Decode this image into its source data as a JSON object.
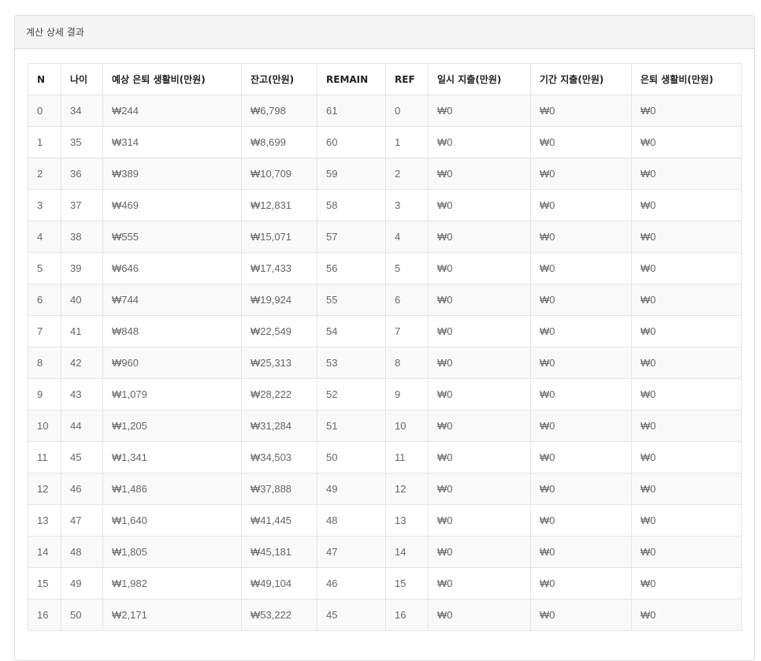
{
  "panel": {
    "title": "계산 상세 결과"
  },
  "table": {
    "headers": [
      "N",
      "나이",
      "예상 은퇴 생활비(만원)",
      "잔고(만원)",
      "REMAIN",
      "REF",
      "일시 지출(만원)",
      "기간 지출(만원)",
      "은퇴 생활비(만원)"
    ],
    "rows": [
      [
        "0",
        "34",
        "₩244",
        "₩6,798",
        "61",
        "0",
        "₩0",
        "₩0",
        "₩0"
      ],
      [
        "1",
        "35",
        "₩314",
        "₩8,699",
        "60",
        "1",
        "₩0",
        "₩0",
        "₩0"
      ],
      [
        "2",
        "36",
        "₩389",
        "₩10,709",
        "59",
        "2",
        "₩0",
        "₩0",
        "₩0"
      ],
      [
        "3",
        "37",
        "₩469",
        "₩12,831",
        "58",
        "3",
        "₩0",
        "₩0",
        "₩0"
      ],
      [
        "4",
        "38",
        "₩555",
        "₩15,071",
        "57",
        "4",
        "₩0",
        "₩0",
        "₩0"
      ],
      [
        "5",
        "39",
        "₩646",
        "₩17,433",
        "56",
        "5",
        "₩0",
        "₩0",
        "₩0"
      ],
      [
        "6",
        "40",
        "₩744",
        "₩19,924",
        "55",
        "6",
        "₩0",
        "₩0",
        "₩0"
      ],
      [
        "7",
        "41",
        "₩848",
        "₩22,549",
        "54",
        "7",
        "₩0",
        "₩0",
        "₩0"
      ],
      [
        "8",
        "42",
        "₩960",
        "₩25,313",
        "53",
        "8",
        "₩0",
        "₩0",
        "₩0"
      ],
      [
        "9",
        "43",
        "₩1,079",
        "₩28,222",
        "52",
        "9",
        "₩0",
        "₩0",
        "₩0"
      ],
      [
        "10",
        "44",
        "₩1,205",
        "₩31,284",
        "51",
        "10",
        "₩0",
        "₩0",
        "₩0"
      ],
      [
        "11",
        "45",
        "₩1,341",
        "₩34,503",
        "50",
        "11",
        "₩0",
        "₩0",
        "₩0"
      ],
      [
        "12",
        "46",
        "₩1,486",
        "₩37,888",
        "49",
        "12",
        "₩0",
        "₩0",
        "₩0"
      ],
      [
        "13",
        "47",
        "₩1,640",
        "₩41,445",
        "48",
        "13",
        "₩0",
        "₩0",
        "₩0"
      ],
      [
        "14",
        "48",
        "₩1,805",
        "₩45,181",
        "47",
        "14",
        "₩0",
        "₩0",
        "₩0"
      ],
      [
        "15",
        "49",
        "₩1,982",
        "₩49,104",
        "46",
        "15",
        "₩0",
        "₩0",
        "₩0"
      ],
      [
        "16",
        "50",
        "₩2,171",
        "₩53,222",
        "45",
        "16",
        "₩0",
        "₩0",
        "₩0"
      ]
    ]
  }
}
